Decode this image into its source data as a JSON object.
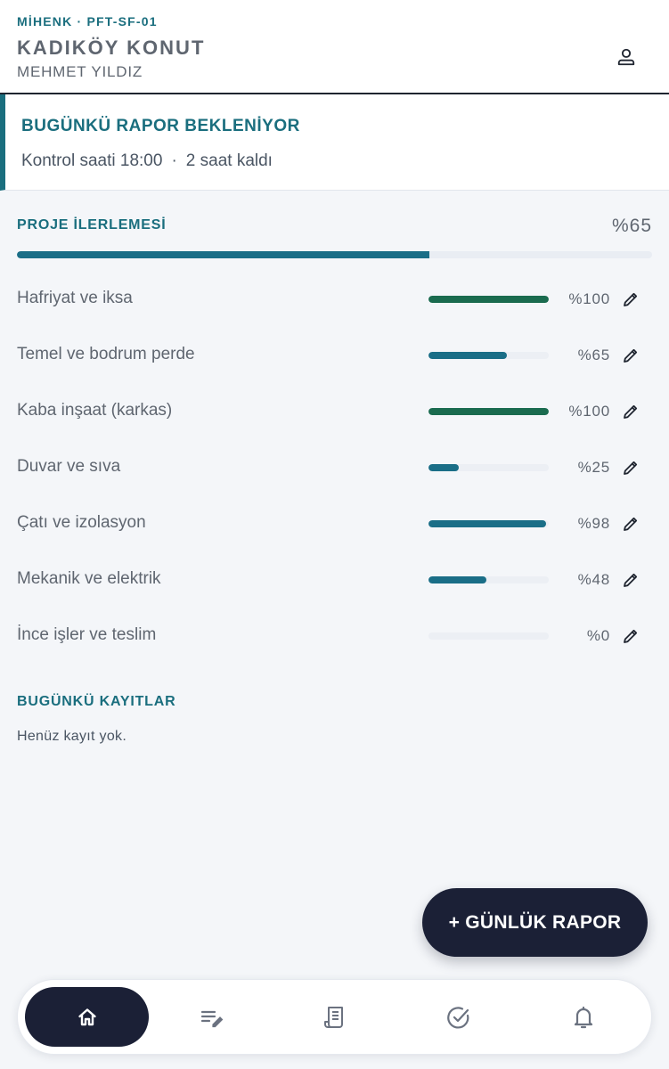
{
  "header": {
    "brand": "MİHENK · PFT-SF-01",
    "project_name": "KADIKÖY KONUT",
    "user_name": "MEHMET YILDIZ",
    "profile_icon": "user-icon"
  },
  "alert": {
    "title": "BUGÜNKÜ RAPOR BEKLENİYOR",
    "control_time": "Kontrol saati 18:00",
    "separator": "·",
    "remaining": "2 saat kaldı"
  },
  "progress": {
    "title": "PROJE İLERLEMESİ",
    "total_label": "%65",
    "total_value": 65,
    "phases": [
      {
        "label": "Hafriyat ve iksa",
        "pct_label": "%100",
        "value": 100,
        "color": "#1a6b4f"
      },
      {
        "label": "Temel ve bodrum perde",
        "pct_label": "%65",
        "value": 65,
        "color": "#1a6e87"
      },
      {
        "label": "Kaba inşaat (karkas)",
        "pct_label": "%100",
        "value": 100,
        "color": "#1a6b4f"
      },
      {
        "label": "Duvar ve sıva",
        "pct_label": "%25",
        "value": 25,
        "color": "#1a6e87"
      },
      {
        "label": "Çatı ve izolasyon",
        "pct_label": "%98",
        "value": 98,
        "color": "#1a6e87"
      },
      {
        "label": "Mekanik ve elektrik",
        "pct_label": "%48",
        "value": 48,
        "color": "#1a6e87"
      },
      {
        "label": "İnce işler ve teslim",
        "pct_label": "%0",
        "value": 0,
        "color": "#1a6e87"
      }
    ]
  },
  "records": {
    "title": "BUGÜNKÜ KAYITLAR",
    "empty_text": "Henüz kayıt yok."
  },
  "fab": {
    "label": "+ GÜNLÜK RAPOR"
  },
  "nav": {
    "items": [
      {
        "icon": "home-icon",
        "active": true
      },
      {
        "icon": "edit-list-icon",
        "active": false
      },
      {
        "icon": "receipt-icon",
        "active": false
      },
      {
        "icon": "check-circle-icon",
        "active": false
      },
      {
        "icon": "bell-icon",
        "active": false
      }
    ]
  },
  "colors": {
    "accent": "#1a6e7e",
    "bar_complete": "#1a6b4f",
    "bar_progress": "#1a6e87",
    "dark": "#1b2036"
  }
}
